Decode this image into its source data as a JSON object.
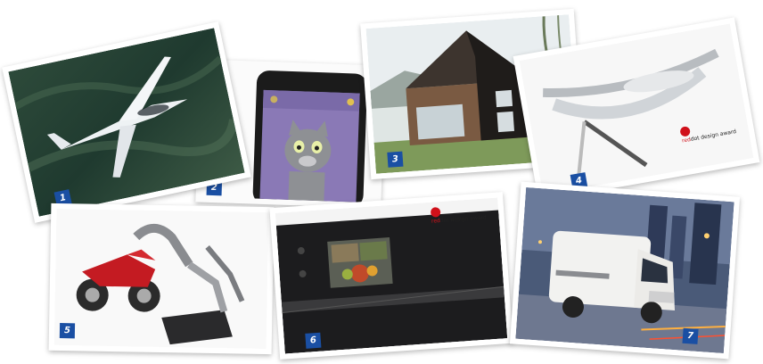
{
  "cards": [
    {
      "number": "1",
      "subject": "airplane"
    },
    {
      "number": "2",
      "subject": "smartphone"
    },
    {
      "number": "3",
      "subject": "house"
    },
    {
      "number": "4",
      "subject": "glasses"
    },
    {
      "number": "5",
      "subject": "motorcycle"
    },
    {
      "number": "6",
      "subject": "oven"
    },
    {
      "number": "7",
      "subject": "camper-van"
    }
  ],
  "award": {
    "red_part": "red",
    "rest": "dot design award"
  },
  "colors": {
    "badge": "#1a4fa3",
    "award_red": "#d0101a"
  }
}
